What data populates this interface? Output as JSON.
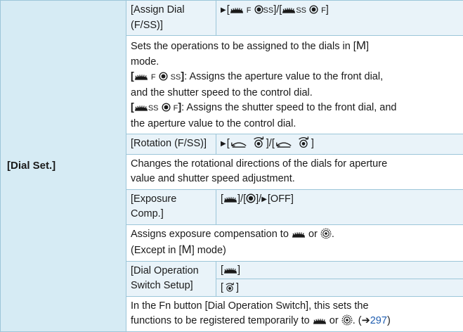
{
  "left_label": "[Dial Set.]",
  "assign_dial": {
    "name": "[Assign Dial (F/SS)]",
    "f_text": "F",
    "ss_text": "SS",
    "f_text2": "F",
    "ss_text2": "SS",
    "desc_line1_a": "Sets the operations to be assigned to the dials in [",
    "mode_letter": "M",
    "desc_line1_b": "]",
    "desc_line2": "mode.",
    "opt1_f": "F",
    "opt1_ss": "SS",
    "opt1_text": ": Assigns the aperture value to the front dial,",
    "opt1_line2": "and the shutter speed to the control dial.",
    "opt2_ss": "SS",
    "opt2_f": "F",
    "opt2_text": ": Assigns the shutter speed to the front dial, and",
    "opt2_line2": "the aperture value to the control dial."
  },
  "rotation": {
    "name": "[Rotation (F/SS)]",
    "desc_line1": "Changes the rotational directions of the dials for aperture",
    "desc_line2": "value and shutter speed adjustment."
  },
  "exposure": {
    "name": "[Exposure Comp.]",
    "setting_off": "[OFF]",
    "desc_line1_a": "Assigns exposure compensation to",
    "desc_line1_or": "or",
    "desc_line2_a": "(Except in [",
    "mode_letter": "M",
    "desc_line2_b": "] mode)"
  },
  "dial_switch": {
    "name_line1": "[Dial Operation",
    "name_line2": "Switch Setup]",
    "desc_line1": "In the Fn button [Dial Operation Switch], this sets the",
    "desc_line2_a": "functions to be registered temporarily to",
    "desc_line2_or": "or",
    "ref_arrow": "➔",
    "ref_page": "297"
  },
  "icons": [
    "front-dial-icon",
    "control-dial-icon",
    "rear-dial-icon",
    "rotation-left-icon",
    "rotation-right-icon",
    "selected-triangle-icon"
  ],
  "colors": {
    "left_bg": "#d6ebf4",
    "sub_bg": "#e9f3f9",
    "border": "#9cc6d9",
    "link": "#1f5db0"
  }
}
